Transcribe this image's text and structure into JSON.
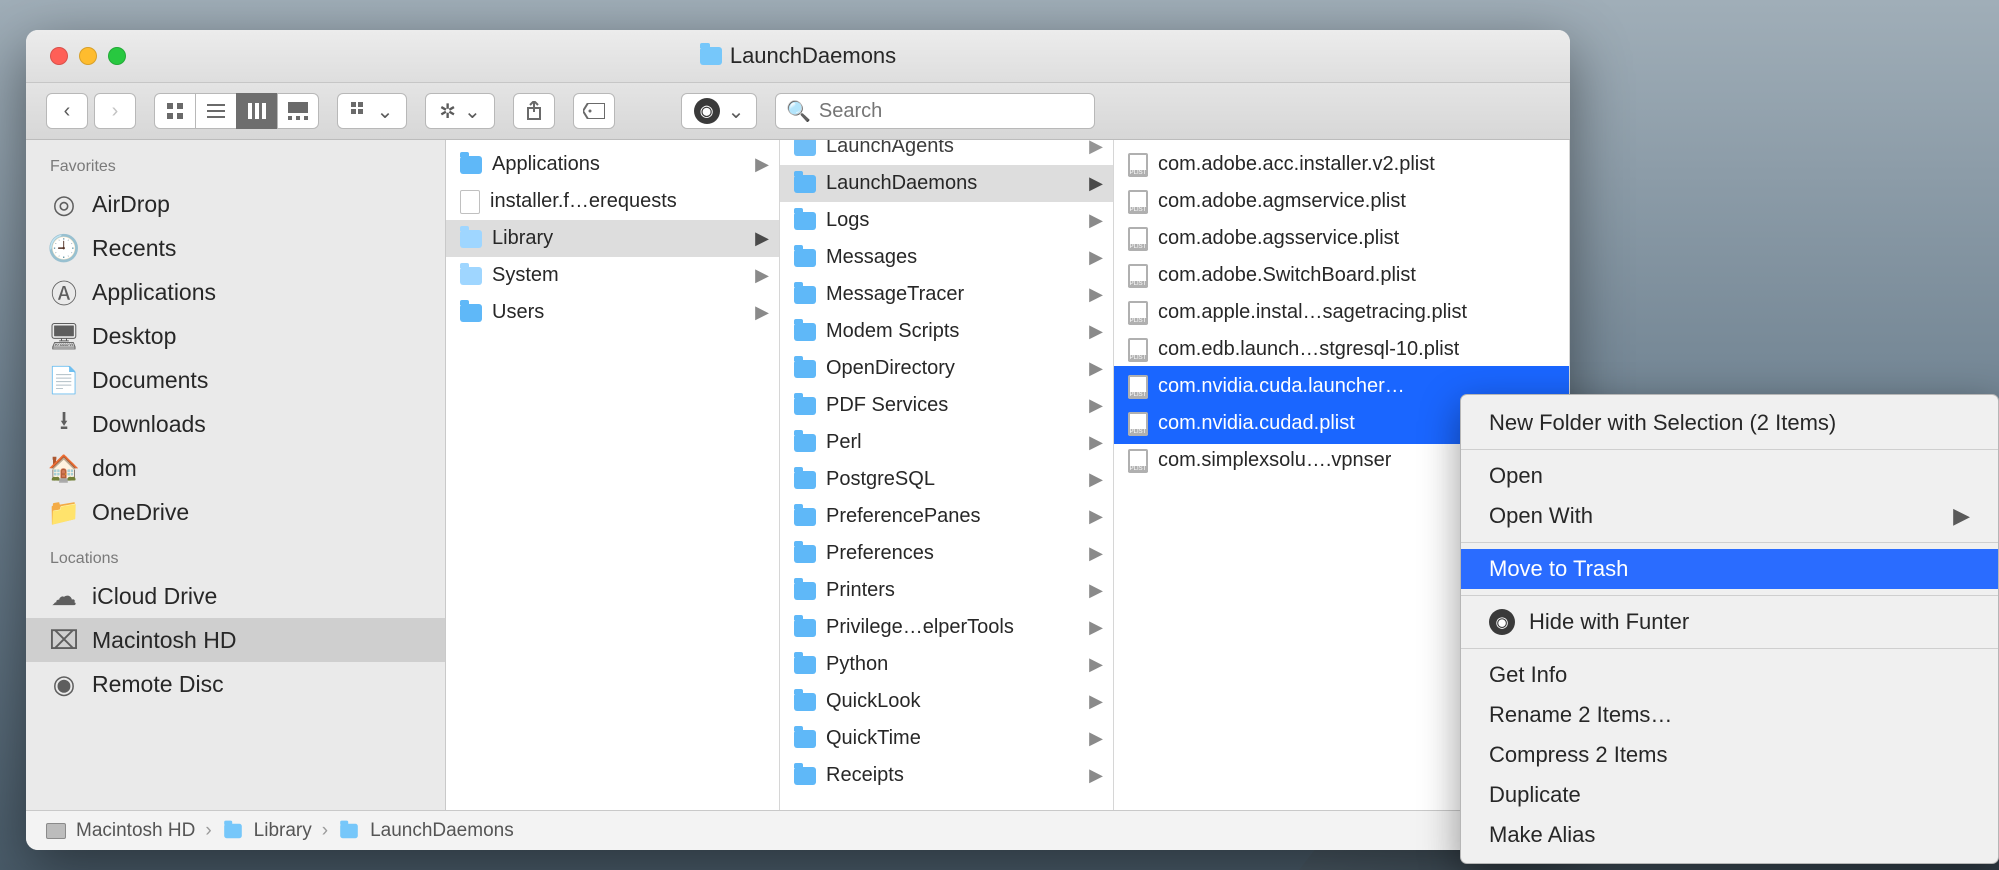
{
  "window": {
    "title": "LaunchDaemons"
  },
  "toolbar": {
    "search_placeholder": "Search"
  },
  "sidebar": {
    "sections": [
      {
        "title": "Favorites",
        "items": [
          {
            "label": "AirDrop",
            "icon": "airdrop"
          },
          {
            "label": "Recents",
            "icon": "clock"
          },
          {
            "label": "Applications",
            "icon": "apps"
          },
          {
            "label": "Desktop",
            "icon": "desktop"
          },
          {
            "label": "Documents",
            "icon": "docs"
          },
          {
            "label": "Downloads",
            "icon": "downloads"
          },
          {
            "label": "dom",
            "icon": "home"
          },
          {
            "label": "OneDrive",
            "icon": "folder"
          }
        ]
      },
      {
        "title": "Locations",
        "items": [
          {
            "label": "iCloud Drive",
            "icon": "cloud"
          },
          {
            "label": "Macintosh HD",
            "icon": "hd",
            "selected": true
          },
          {
            "label": "Remote Disc",
            "icon": "disc"
          }
        ]
      }
    ]
  },
  "columns": {
    "col1": [
      {
        "label": "Applications",
        "kind": "folder",
        "arrow": true
      },
      {
        "label": "installer.f…erequests",
        "kind": "doc"
      },
      {
        "label": "Library",
        "kind": "sysfolder",
        "arrow": true,
        "selected": true
      },
      {
        "label": "System",
        "kind": "sysfolder",
        "arrow": true
      },
      {
        "label": "Users",
        "kind": "folder",
        "arrow": true
      }
    ],
    "col2": [
      {
        "label": "LaunchAgents",
        "kind": "folder",
        "arrow": true,
        "partial": true
      },
      {
        "label": "LaunchDaemons",
        "kind": "folder",
        "arrow": true,
        "selected": true
      },
      {
        "label": "Logs",
        "kind": "folder",
        "arrow": true
      },
      {
        "label": "Messages",
        "kind": "folder",
        "arrow": true
      },
      {
        "label": "MessageTracer",
        "kind": "folder",
        "arrow": true
      },
      {
        "label": "Modem Scripts",
        "kind": "folder",
        "arrow": true
      },
      {
        "label": "OpenDirectory",
        "kind": "folder",
        "arrow": true
      },
      {
        "label": "PDF Services",
        "kind": "folder",
        "arrow": true
      },
      {
        "label": "Perl",
        "kind": "folder",
        "arrow": true
      },
      {
        "label": "PostgreSQL",
        "kind": "folder",
        "arrow": true
      },
      {
        "label": "PreferencePanes",
        "kind": "folder",
        "arrow": true
      },
      {
        "label": "Preferences",
        "kind": "folder",
        "arrow": true
      },
      {
        "label": "Printers",
        "kind": "folder",
        "arrow": true
      },
      {
        "label": "Privilege…elperTools",
        "kind": "folder",
        "arrow": true
      },
      {
        "label": "Python",
        "kind": "folder",
        "arrow": true
      },
      {
        "label": "QuickLook",
        "kind": "folder",
        "arrow": true
      },
      {
        "label": "QuickTime",
        "kind": "folder",
        "arrow": true
      },
      {
        "label": "Receipts",
        "kind": "folder",
        "arrow": true
      }
    ],
    "col3": [
      {
        "label": "com.adobe.acc.installer.v2.plist",
        "kind": "plist"
      },
      {
        "label": "com.adobe.agmservice.plist",
        "kind": "plist"
      },
      {
        "label": "com.adobe.agsservice.plist",
        "kind": "plist"
      },
      {
        "label": "com.adobe.SwitchBoard.plist",
        "kind": "plist"
      },
      {
        "label": "com.apple.instal…sagetracing.plist",
        "kind": "plist"
      },
      {
        "label": "com.edb.launch…stgresql-10.plist",
        "kind": "plist"
      },
      {
        "label": "com.nvidia.cuda.launcher…",
        "kind": "plist",
        "selected": true
      },
      {
        "label": "com.nvidia.cudad.plist",
        "kind": "plist",
        "selected": true
      },
      {
        "label": "com.simplexsolu….vpnser",
        "kind": "plist"
      }
    ]
  },
  "pathbar": {
    "items": [
      {
        "label": "Macintosh HD",
        "icon": "hd"
      },
      {
        "label": "Library",
        "icon": "folder"
      },
      {
        "label": "LaunchDaemons",
        "icon": "folder"
      }
    ]
  },
  "context_menu": {
    "items": [
      {
        "label": "New Folder with Selection (2 Items)"
      },
      {
        "sep": true
      },
      {
        "label": "Open"
      },
      {
        "label": "Open With",
        "submenu": true
      },
      {
        "sep": true
      },
      {
        "label": "Move to Trash",
        "highlight": true
      },
      {
        "sep": true
      },
      {
        "label": "Hide with Funter",
        "icon": "eye"
      },
      {
        "sep": true
      },
      {
        "label": "Get Info"
      },
      {
        "label": "Rename 2 Items…"
      },
      {
        "label": "Compress 2 Items"
      },
      {
        "label": "Duplicate"
      },
      {
        "label": "Make Alias"
      }
    ]
  }
}
